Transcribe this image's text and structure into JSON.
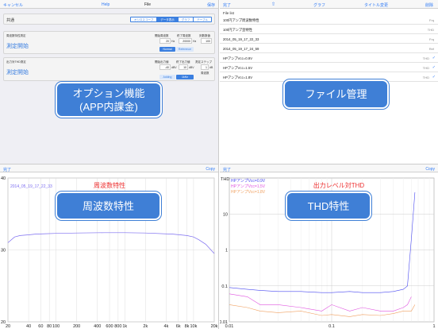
{
  "colors": {
    "accent": "#2f7af5",
    "overlay": "#3f7fd6",
    "title_red": "#e33"
  },
  "q1": {
    "nav": {
      "left": "キャンセル",
      "help": "Help",
      "title": "File",
      "save": "保存"
    },
    "section": "共通",
    "tabs": [
      "オシロスコープ",
      "データ表示",
      "グラフ",
      "テーブル"
    ],
    "freq": {
      "heading": "周波数特性測定",
      "start": "測定開始",
      "col1": "開始周波数",
      "col2": "終了周波数",
      "col3": "刻数数値",
      "v1": "20",
      "u1": "Hz",
      "v2": "20000",
      "u2": "Hz",
      "v3": "100",
      "b1": "Normal",
      "b2": "Reference"
    },
    "thd": {
      "heading": "出力対THD測定",
      "start": "測定開始",
      "col1": "開始出力値",
      "col2": "終了出力値",
      "col3": "測定ステップ",
      "v1": "-40",
      "u1": "dBV",
      "v2": "10",
      "u2": "dBV",
      "v3": "1",
      "u3": "dB",
      "extra": "周波数",
      "b1": "Adding",
      "b2": "1kHz"
    },
    "overlay": [
      "オプション機能",
      "(APP内課金)"
    ]
  },
  "q2": {
    "nav": {
      "left": "完了",
      "share": "⇧",
      "graph": "グラフ",
      "rename": "タイトル変更",
      "delete": "削除"
    },
    "list_title": "File list",
    "files": [
      {
        "name": "100円アンプ周波数特性",
        "tag": "Frq",
        "checked": false
      },
      {
        "name": "100円アンプ歪特性",
        "tag": "THD",
        "checked": false
      },
      {
        "name": "2014_05_19_17_22_33",
        "tag": "Frq",
        "checked": false
      },
      {
        "name": "2014_05_19_17_24_59",
        "tag": "Ref",
        "checked": false
      },
      {
        "name": "HPアンプVcc=0.9V",
        "tag": "THD",
        "checked": true
      },
      {
        "name": "HPアンプVcc=1.5V",
        "tag": "THD",
        "checked": true
      },
      {
        "name": "HPアンプVcc=1.8V",
        "tag": "THD",
        "checked": true
      }
    ],
    "overlay": "ファイル管理"
  },
  "q3": {
    "nav": {
      "left": "完了",
      "right": "Copy"
    },
    "overlay": "周波数特性"
  },
  "q4": {
    "nav": {
      "left": "完了",
      "right": "Copy"
    },
    "overlay": "THD特性"
  },
  "chart_data": [
    {
      "type": "line",
      "title": "周波数特性",
      "series": [
        {
          "name": "2014_05_19_17_22_33",
          "color": "#7b6cf0",
          "x": [
            20,
            25,
            30,
            40,
            50,
            70,
            100,
            200,
            500,
            1000,
            2000,
            5000,
            8000,
            10000,
            12000,
            15000,
            20000
          ],
          "y": [
            31.0,
            31.8,
            32.0,
            32.1,
            32.2,
            32.25,
            32.3,
            32.35,
            32.4,
            32.4,
            32.35,
            32.2,
            32.0,
            31.8,
            31.4,
            30.8,
            29.5
          ]
        }
      ],
      "xscale": "log",
      "xlim": [
        20,
        20000
      ],
      "xticks": [
        "20",
        "40",
        "60",
        "80",
        "100",
        "200",
        "400",
        "600",
        "800",
        "1k",
        "2k",
        "4k",
        "6k",
        "8k",
        "10k",
        "20k"
      ],
      "ylim": [
        20,
        40
      ],
      "yticks": [
        "20",
        "30",
        "40"
      ]
    },
    {
      "type": "line",
      "title": "出力レベル対THD",
      "series": [
        {
          "name": "HPアンプVcc=0.9V",
          "color": "#4a4af0",
          "x": [
            0.01,
            0.015,
            0.02,
            0.03,
            0.05,
            0.08,
            0.1,
            0.15,
            0.2,
            0.3,
            0.4,
            0.5,
            0.55,
            0.6,
            0.65
          ],
          "y": [
            0.09,
            0.08,
            0.075,
            0.07,
            0.07,
            0.065,
            0.065,
            0.07,
            0.065,
            0.065,
            0.07,
            0.08,
            0.1,
            2,
            40
          ]
        },
        {
          "name": "HPアンプVcc=1.5V",
          "color": "#e055e0",
          "x": [
            0.01,
            0.015,
            0.02,
            0.03,
            0.05,
            0.08,
            0.1,
            0.15,
            0.2,
            0.3,
            0.4,
            0.5,
            0.55,
            0.6
          ],
          "y": [
            0.06,
            0.05,
            0.03,
            0.03,
            0.025,
            0.02,
            0.03,
            0.02,
            0.025,
            0.02,
            0.02,
            0.025,
            0.03,
            0.05
          ]
        },
        {
          "name": "HPアンプVcc=1.8V",
          "color": "#f0a060",
          "x": [
            0.01,
            0.015,
            0.02,
            0.03,
            0.05,
            0.08,
            0.1,
            0.15,
            0.2,
            0.3,
            0.4,
            0.5,
            0.6,
            0.65
          ],
          "y": [
            0.03,
            0.025,
            0.02,
            0.018,
            0.02,
            0.015,
            0.016,
            0.014,
            0.016,
            0.015,
            0.017,
            0.02,
            0.02,
            0.03
          ]
        }
      ],
      "xscale": "log",
      "xlim": [
        0.01,
        1
      ],
      "xticks": [
        "0.01",
        "0.1",
        "1"
      ],
      "yscale": "log",
      "ylim": [
        0.01,
        100
      ],
      "yticks": [
        "0.01",
        "0.1",
        "1",
        "10"
      ],
      "ylabel": "THD"
    }
  ]
}
